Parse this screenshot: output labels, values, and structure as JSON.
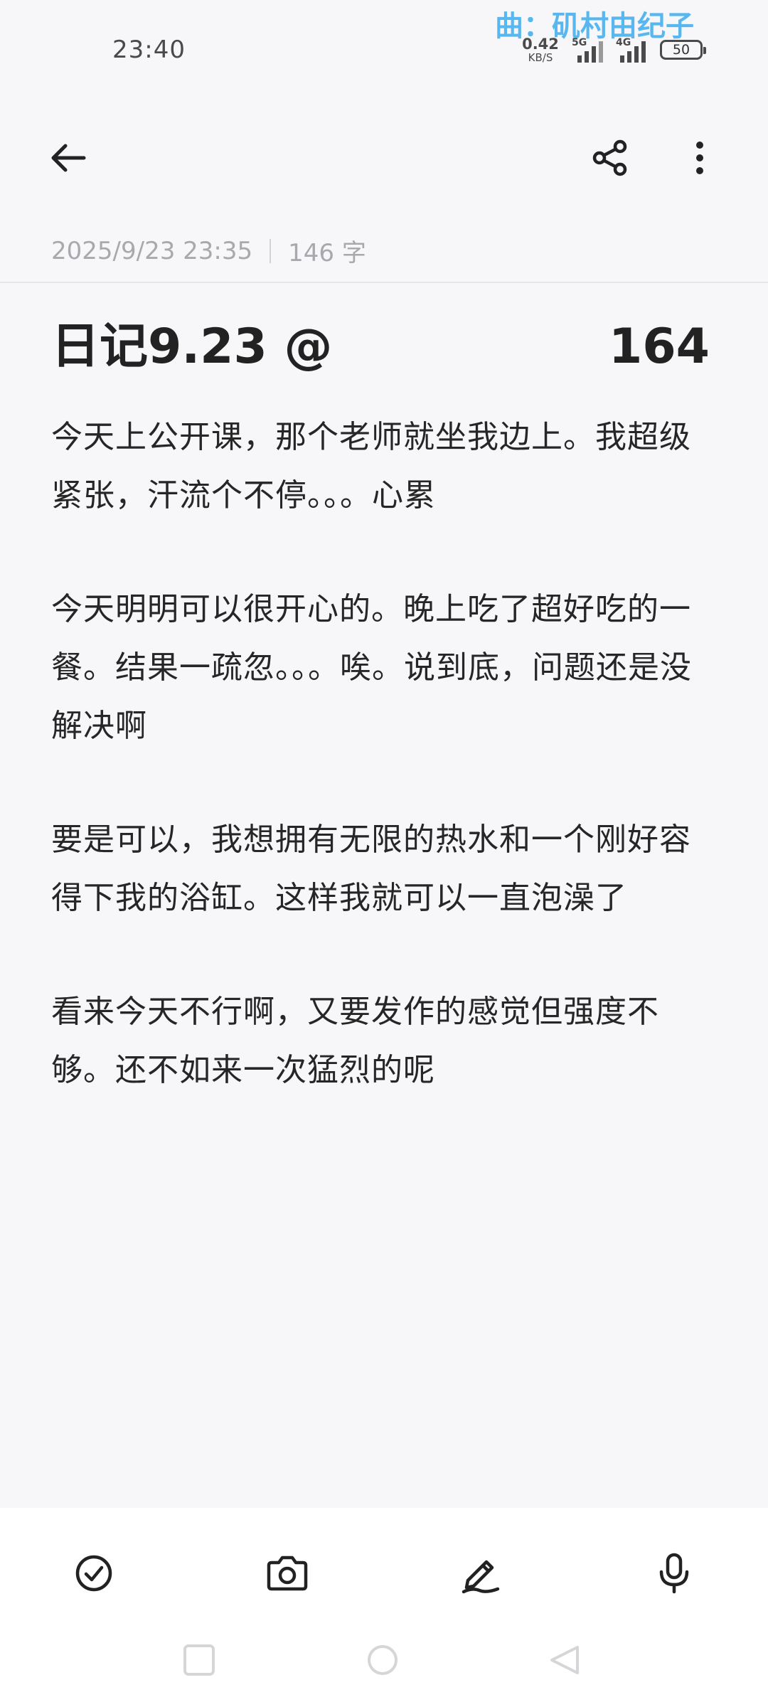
{
  "status_bar": {
    "time": "23:40",
    "lyric": "曲：矶村由纪子",
    "net_speed_value": "0.42",
    "net_speed_unit": "KB/S",
    "signal_1_label": "5G",
    "signal_2_label": "4G",
    "battery_level": "50"
  },
  "app_bar": {
    "back_icon": "arrow-left-icon",
    "share_icon": "share-icon",
    "more_icon": "more-vertical-icon"
  },
  "note": {
    "date": "2025/9/23 23:35",
    "char_count": "146 字",
    "title": "日记9.23  @",
    "title_number": "164",
    "paragraphs": [
      "今天上公开课，那个老师就坐我边上。我超级紧张，汗流个不停。。。心累",
      "今天明明可以很开心的。晚上吃了超好吃的一餐。结果一疏忽。。。唉。说到底，问题还是没解决啊",
      "要是可以，我想拥有无限的热水和一个刚好容得下我的浴缸。这样我就可以一直泡澡了",
      "看来今天不行啊，又要发作的感觉但强度不够。还不如来一次猛烈的呢"
    ]
  },
  "toolbar": {
    "items": [
      "checklist-icon",
      "camera-icon",
      "handwriting-icon",
      "microphone-icon"
    ]
  },
  "colors": {
    "background": "#f7f7f9",
    "lyric": "#59b7f0",
    "meta_text": "#a9a9ad",
    "toolbar_bg": "#ffffff"
  }
}
